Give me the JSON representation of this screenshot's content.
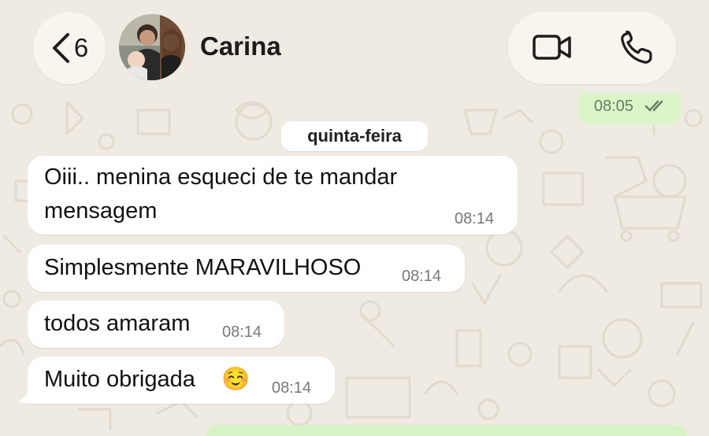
{
  "header": {
    "back_count": "6",
    "contact_name": "Carina",
    "avatar": "contact-photo"
  },
  "icons": {
    "back": "chevron-left-icon",
    "video": "video-camera-icon",
    "phone": "phone-icon",
    "read": "double-check-icon",
    "emoji": "smiling-face-emoji"
  },
  "colors": {
    "background": "#efeae2",
    "incoming_bubble": "#ffffff",
    "outgoing_bubble": "#dbf5c9",
    "header_pill": "#f8f5ee"
  },
  "chat": {
    "previous_outgoing_time": "08:05",
    "day_separator": "quinta-feira",
    "messages": [
      {
        "line1": "Oiii.. menina esqueci de te mandar",
        "line2": "mensagem",
        "time": "08:14"
      },
      {
        "text": "Simplesmente MARAVILHOSO",
        "time": "08:14"
      },
      {
        "text": "todos amaram",
        "time": "08:14"
      },
      {
        "text": "Muito obrigada",
        "emoji": "☺️",
        "time": "08:14"
      }
    ]
  }
}
